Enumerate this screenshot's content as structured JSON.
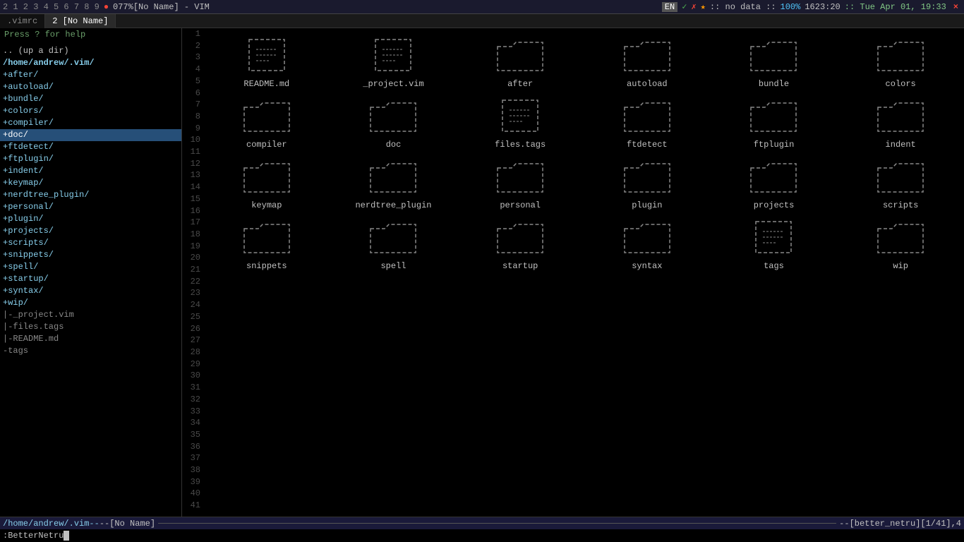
{
  "titlebar": {
    "tabs": [
      "2",
      "1",
      "2",
      "3",
      "4",
      "5",
      "6",
      "7",
      "8",
      "9"
    ],
    "filename": "[No Name] - VIM",
    "encoding": "EN",
    "indicators": [
      "✓",
      "✗"
    ],
    "nodata": "no data",
    "percent": "100%",
    "position": "1623:20",
    "datetime": "Tue Apr 01, 19:33",
    "close": "×"
  },
  "tabs": [
    {
      "label": ".vimrc",
      "active": false
    },
    {
      "label": "2 [No Name]",
      "active": true
    }
  ],
  "sidebar": {
    "help": "Press ? for help",
    "items": [
      {
        "label": ".. (up a dir)",
        "type": "up"
      },
      {
        "label": "/home/andrew/.vim/",
        "type": "root"
      },
      {
        "label": "+after/",
        "type": "folder-open"
      },
      {
        "label": "+autoload/",
        "type": "folder-open"
      },
      {
        "label": "+bundle/",
        "type": "folder-open"
      },
      {
        "label": "+colors/",
        "type": "folder-open"
      },
      {
        "label": "+compiler/",
        "type": "folder-open"
      },
      {
        "label": "+doc/",
        "type": "folder-open",
        "selected": true
      },
      {
        "label": "+ftdetect/",
        "type": "folder-open"
      },
      {
        "label": "+ftplugin/",
        "type": "folder-open"
      },
      {
        "label": "+indent/",
        "type": "folder-open"
      },
      {
        "label": "+keymap/",
        "type": "folder-open"
      },
      {
        "label": "+nerdtree_plugin/",
        "type": "folder-open"
      },
      {
        "label": "+personal/",
        "type": "folder-open"
      },
      {
        "label": "+plugin/",
        "type": "folder-open"
      },
      {
        "label": "+projects/",
        "type": "folder-open"
      },
      {
        "label": "+scripts/",
        "type": "folder-open"
      },
      {
        "label": "+snippets/",
        "type": "folder-open"
      },
      {
        "label": "+spell/",
        "type": "folder-open"
      },
      {
        "label": "+startup/",
        "type": "folder-open"
      },
      {
        "label": "+syntax/",
        "type": "folder-open"
      },
      {
        "label": "+wip/",
        "type": "folder-open"
      },
      {
        "label": "|-_project.vim",
        "type": "file-dash"
      },
      {
        "label": "|-files.tags",
        "type": "file-dash"
      },
      {
        "label": "|-README.md",
        "type": "file-dash"
      },
      {
        "label": "-tags",
        "type": "file-dash"
      }
    ]
  },
  "netrw": {
    "items": [
      {
        "name": "README.md",
        "type": "file"
      },
      {
        "name": "_project.vim",
        "type": "file"
      },
      {
        "name": "after",
        "type": "folder"
      },
      {
        "name": "autoload",
        "type": "folder"
      },
      {
        "name": "bundle",
        "type": "folder"
      },
      {
        "name": "colors",
        "type": "folder"
      },
      {
        "name": "compiler",
        "type": "folder"
      },
      {
        "name": "doc",
        "type": "folder"
      },
      {
        "name": "files.tags",
        "type": "file"
      },
      {
        "name": "ftdetect",
        "type": "folder"
      },
      {
        "name": "ftplugin",
        "type": "folder"
      },
      {
        "name": "indent",
        "type": "folder"
      },
      {
        "name": "keymap",
        "type": "folder"
      },
      {
        "name": "nerdtree_plugin",
        "type": "folder"
      },
      {
        "name": "personal",
        "type": "folder"
      },
      {
        "name": "plugin",
        "type": "folder"
      },
      {
        "name": "projects",
        "type": "folder"
      },
      {
        "name": "scripts",
        "type": "folder"
      },
      {
        "name": "snippets",
        "type": "folder"
      },
      {
        "name": "spell",
        "type": "folder"
      },
      {
        "name": "startup",
        "type": "folder"
      },
      {
        "name": "syntax",
        "type": "folder"
      },
      {
        "name": "tags",
        "type": "file"
      },
      {
        "name": "wip",
        "type": "folder"
      }
    ]
  },
  "line_numbers": [
    1,
    2,
    3,
    4,
    5,
    6,
    7,
    8,
    9,
    10,
    11,
    12,
    13,
    14,
    15,
    16,
    17,
    18,
    19,
    20,
    21,
    22,
    23,
    24,
    25,
    26,
    27,
    28,
    29,
    30,
    31,
    32,
    33,
    34,
    35,
    36,
    37,
    38,
    39,
    40,
    41
  ],
  "statusbar": {
    "left": "/home/andrew/.vim",
    "middle": "[No Name]",
    "right": "[better_netru][1/41],4"
  },
  "cmdline": {
    "text": ":BetterNetru"
  }
}
